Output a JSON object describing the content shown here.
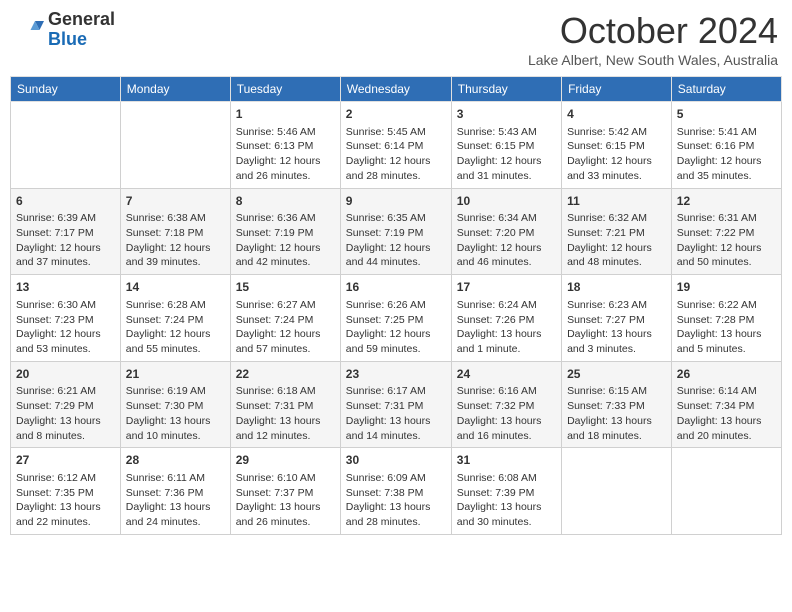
{
  "header": {
    "logo_general": "General",
    "logo_blue": "Blue",
    "month_title": "October 2024",
    "location": "Lake Albert, New South Wales, Australia"
  },
  "days_of_week": [
    "Sunday",
    "Monday",
    "Tuesday",
    "Wednesday",
    "Thursday",
    "Friday",
    "Saturday"
  ],
  "weeks": [
    [
      {
        "day": "",
        "info": ""
      },
      {
        "day": "",
        "info": ""
      },
      {
        "day": "1",
        "info": "Sunrise: 5:46 AM\nSunset: 6:13 PM\nDaylight: 12 hours\nand 26 minutes."
      },
      {
        "day": "2",
        "info": "Sunrise: 5:45 AM\nSunset: 6:14 PM\nDaylight: 12 hours\nand 28 minutes."
      },
      {
        "day": "3",
        "info": "Sunrise: 5:43 AM\nSunset: 6:15 PM\nDaylight: 12 hours\nand 31 minutes."
      },
      {
        "day": "4",
        "info": "Sunrise: 5:42 AM\nSunset: 6:15 PM\nDaylight: 12 hours\nand 33 minutes."
      },
      {
        "day": "5",
        "info": "Sunrise: 5:41 AM\nSunset: 6:16 PM\nDaylight: 12 hours\nand 35 minutes."
      }
    ],
    [
      {
        "day": "6",
        "info": "Sunrise: 6:39 AM\nSunset: 7:17 PM\nDaylight: 12 hours\nand 37 minutes."
      },
      {
        "day": "7",
        "info": "Sunrise: 6:38 AM\nSunset: 7:18 PM\nDaylight: 12 hours\nand 39 minutes."
      },
      {
        "day": "8",
        "info": "Sunrise: 6:36 AM\nSunset: 7:19 PM\nDaylight: 12 hours\nand 42 minutes."
      },
      {
        "day": "9",
        "info": "Sunrise: 6:35 AM\nSunset: 7:19 PM\nDaylight: 12 hours\nand 44 minutes."
      },
      {
        "day": "10",
        "info": "Sunrise: 6:34 AM\nSunset: 7:20 PM\nDaylight: 12 hours\nand 46 minutes."
      },
      {
        "day": "11",
        "info": "Sunrise: 6:32 AM\nSunset: 7:21 PM\nDaylight: 12 hours\nand 48 minutes."
      },
      {
        "day": "12",
        "info": "Sunrise: 6:31 AM\nSunset: 7:22 PM\nDaylight: 12 hours\nand 50 minutes."
      }
    ],
    [
      {
        "day": "13",
        "info": "Sunrise: 6:30 AM\nSunset: 7:23 PM\nDaylight: 12 hours\nand 53 minutes."
      },
      {
        "day": "14",
        "info": "Sunrise: 6:28 AM\nSunset: 7:24 PM\nDaylight: 12 hours\nand 55 minutes."
      },
      {
        "day": "15",
        "info": "Sunrise: 6:27 AM\nSunset: 7:24 PM\nDaylight: 12 hours\nand 57 minutes."
      },
      {
        "day": "16",
        "info": "Sunrise: 6:26 AM\nSunset: 7:25 PM\nDaylight: 12 hours\nand 59 minutes."
      },
      {
        "day": "17",
        "info": "Sunrise: 6:24 AM\nSunset: 7:26 PM\nDaylight: 13 hours\nand 1 minute."
      },
      {
        "day": "18",
        "info": "Sunrise: 6:23 AM\nSunset: 7:27 PM\nDaylight: 13 hours\nand 3 minutes."
      },
      {
        "day": "19",
        "info": "Sunrise: 6:22 AM\nSunset: 7:28 PM\nDaylight: 13 hours\nand 5 minutes."
      }
    ],
    [
      {
        "day": "20",
        "info": "Sunrise: 6:21 AM\nSunset: 7:29 PM\nDaylight: 13 hours\nand 8 minutes."
      },
      {
        "day": "21",
        "info": "Sunrise: 6:19 AM\nSunset: 7:30 PM\nDaylight: 13 hours\nand 10 minutes."
      },
      {
        "day": "22",
        "info": "Sunrise: 6:18 AM\nSunset: 7:31 PM\nDaylight: 13 hours\nand 12 minutes."
      },
      {
        "day": "23",
        "info": "Sunrise: 6:17 AM\nSunset: 7:31 PM\nDaylight: 13 hours\nand 14 minutes."
      },
      {
        "day": "24",
        "info": "Sunrise: 6:16 AM\nSunset: 7:32 PM\nDaylight: 13 hours\nand 16 minutes."
      },
      {
        "day": "25",
        "info": "Sunrise: 6:15 AM\nSunset: 7:33 PM\nDaylight: 13 hours\nand 18 minutes."
      },
      {
        "day": "26",
        "info": "Sunrise: 6:14 AM\nSunset: 7:34 PM\nDaylight: 13 hours\nand 20 minutes."
      }
    ],
    [
      {
        "day": "27",
        "info": "Sunrise: 6:12 AM\nSunset: 7:35 PM\nDaylight: 13 hours\nand 22 minutes."
      },
      {
        "day": "28",
        "info": "Sunrise: 6:11 AM\nSunset: 7:36 PM\nDaylight: 13 hours\nand 24 minutes."
      },
      {
        "day": "29",
        "info": "Sunrise: 6:10 AM\nSunset: 7:37 PM\nDaylight: 13 hours\nand 26 minutes."
      },
      {
        "day": "30",
        "info": "Sunrise: 6:09 AM\nSunset: 7:38 PM\nDaylight: 13 hours\nand 28 minutes."
      },
      {
        "day": "31",
        "info": "Sunrise: 6:08 AM\nSunset: 7:39 PM\nDaylight: 13 hours\nand 30 minutes."
      },
      {
        "day": "",
        "info": ""
      },
      {
        "day": "",
        "info": ""
      }
    ]
  ]
}
